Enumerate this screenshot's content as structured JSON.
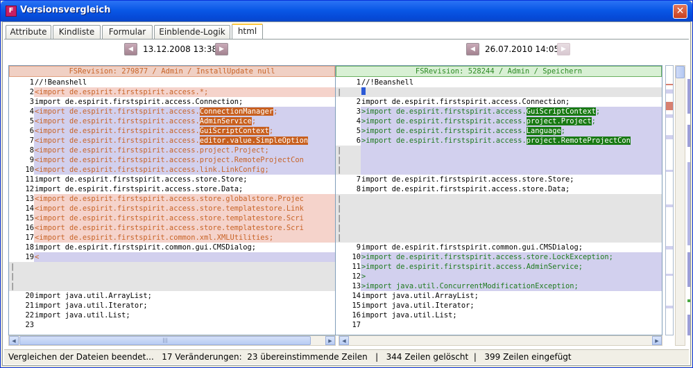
{
  "window": {
    "title": "Versionsvergleich",
    "app_icon": "fs-icon",
    "close_icon": "close-icon"
  },
  "tabs": [
    {
      "label": "Attribute"
    },
    {
      "label": "Kindliste"
    },
    {
      "label": "Formular"
    },
    {
      "label": "Einblende-Logik"
    },
    {
      "label": "html",
      "active": true
    }
  ],
  "left": {
    "date": "13.12.2008 13:38",
    "header": "FSRevision: 279877 / Admin / InstallUpdate null",
    "rows": [
      {
        "n": "1",
        "t": "n",
        "code": "//!Beanshell"
      },
      {
        "n": "2",
        "t": "del",
        "m": "<",
        "code": "import de.espirit.firstspirit.access.*;"
      },
      {
        "n": "3",
        "t": "n",
        "code": "import de.espirit.firstspirit.access.Connection;"
      },
      {
        "n": "4",
        "t": "mod",
        "m": "<",
        "code": "import de.espirit.firstspirit.access.",
        "hl": "ConnectionManager",
        "tail": ";"
      },
      {
        "n": "5",
        "t": "mod",
        "m": "<",
        "code": "import de.espirit.firstspirit.access.",
        "hl": "AdminService",
        "tail": ";"
      },
      {
        "n": "6",
        "t": "mod",
        "m": "<",
        "code": "import de.espirit.firstspirit.access.",
        "hl": "GuiScriptContext",
        "tail": ";"
      },
      {
        "n": "7",
        "t": "mod",
        "m": "<",
        "code": "import de.espirit.firstspirit.access.",
        "hl": "editor.value.SimpleOption",
        "tail": ""
      },
      {
        "n": "8",
        "t": "mod",
        "m": "<",
        "code": "import de.espirit.firstspirit.access.project.Project;"
      },
      {
        "n": "9",
        "t": "mod",
        "m": "<",
        "code": "import de.espirit.firstspirit.access.project.RemoteProjectCon"
      },
      {
        "n": "10",
        "t": "mod",
        "m": "<",
        "code": "import de.espirit.firstspirit.access.link.LinkConfig;"
      },
      {
        "n": "11",
        "t": "n",
        "code": "import de.espirit.firstspirit.access.store.Store;"
      },
      {
        "n": "12",
        "t": "n",
        "code": "import de.espirit.firstspirit.access.store.Data;"
      },
      {
        "n": "13",
        "t": "del",
        "m": "<",
        "code": "import de.espirit.firstspirit.access.store.globalstore.Projec"
      },
      {
        "n": "14",
        "t": "del",
        "m": "<",
        "code": "import de.espirit.firstspirit.access.store.templatestore.Link"
      },
      {
        "n": "15",
        "t": "del",
        "m": "<",
        "code": "import de.espirit.firstspirit.access.store.templatestore.Scri"
      },
      {
        "n": "16",
        "t": "del",
        "m": "<",
        "code": "import de.espirit.firstspirit.access.store.templatestore.Scri"
      },
      {
        "n": "17",
        "t": "del",
        "m": "<",
        "code": "import de.espirit.firstspirit.common.xml.XMLUtilities;"
      },
      {
        "n": "18",
        "t": "n",
        "code": "import de.espirit.firstspirit.common.gui.CMSDialog;"
      },
      {
        "n": "19",
        "t": "mod",
        "m": "<",
        "code": ""
      },
      {
        "n": "",
        "t": "fill",
        "code": ""
      },
      {
        "n": "",
        "t": "fill",
        "code": ""
      },
      {
        "n": "",
        "t": "fill",
        "code": ""
      },
      {
        "n": "20",
        "t": "n",
        "code": "import java.util.ArrayList;"
      },
      {
        "n": "21",
        "t": "n",
        "code": "import java.util.Iterator;"
      },
      {
        "n": "22",
        "t": "n",
        "code": "import java.util.List;"
      },
      {
        "n": "23",
        "t": "n",
        "code": ""
      }
    ]
  },
  "right": {
    "date": "26.07.2010 14:05",
    "header": "FSRevision: 528244 / Admin / Speichern",
    "rows": [
      {
        "n": "1",
        "t": "n",
        "code": "//!Beanshell"
      },
      {
        "n": "",
        "t": "cursor",
        "code": ""
      },
      {
        "n": "2",
        "t": "n",
        "code": "import de.espirit.firstspirit.access.Connection;"
      },
      {
        "n": "3",
        "t": "add",
        "m": ">",
        "code": "import de.espirit.firstspirit.access.",
        "hl": "GuiScriptContext",
        "tail": ";"
      },
      {
        "n": "4",
        "t": "add",
        "m": ">",
        "code": "import de.espirit.firstspirit.access.",
        "hl": "project.Project",
        "tail": ";"
      },
      {
        "n": "5",
        "t": "add",
        "m": ">",
        "code": "import de.espirit.firstspirit.access.",
        "hl": "Language",
        "tail": ";"
      },
      {
        "n": "6",
        "t": "add",
        "m": ">",
        "code": "import de.espirit.firstspirit.access.",
        "hl": "project.RemoteProjectCon",
        "tail": ""
      },
      {
        "n": "",
        "t": "fill2",
        "code": ""
      },
      {
        "n": "",
        "t": "fill2",
        "code": ""
      },
      {
        "n": "",
        "t": "fill2",
        "code": ""
      },
      {
        "n": "7",
        "t": "n",
        "code": "import de.espirit.firstspirit.access.store.Store;"
      },
      {
        "n": "8",
        "t": "n",
        "code": "import de.espirit.firstspirit.access.store.Data;"
      },
      {
        "n": "",
        "t": "fill",
        "code": ""
      },
      {
        "n": "",
        "t": "fill",
        "code": ""
      },
      {
        "n": "",
        "t": "fill",
        "code": ""
      },
      {
        "n": "",
        "t": "fill",
        "code": ""
      },
      {
        "n": "",
        "t": "fill",
        "code": ""
      },
      {
        "n": "9",
        "t": "n",
        "code": "import de.espirit.firstspirit.common.gui.CMSDialog;"
      },
      {
        "n": "10",
        "t": "add",
        "m": ">",
        "code": "import de.espirit.firstspirit.access.store.LockException;"
      },
      {
        "n": "11",
        "t": "add",
        "m": ">",
        "code": "import de.espirit.firstspirit.access.AdminService;"
      },
      {
        "n": "12",
        "t": "add",
        "m": ">",
        "code": ""
      },
      {
        "n": "13",
        "t": "add",
        "m": ">",
        "code": "import java.util.ConcurrentModificationException;"
      },
      {
        "n": "14",
        "t": "n",
        "code": "import java.util.ArrayList;"
      },
      {
        "n": "15",
        "t": "n",
        "code": "import java.util.Iterator;"
      },
      {
        "n": "16",
        "t": "n",
        "code": "import java.util.List;"
      },
      {
        "n": "17",
        "t": "n",
        "code": ""
      }
    ]
  },
  "status": {
    "text": "Vergleichen der Dateien beendet...   17 Veränderungen:  23 übereinstimmende Zeilen   |   344 Zeilen gelöscht  |   399 Zeilen eingefügt"
  },
  "colors": {
    "deleted": "#f5d3cb",
    "changed": "#d2d0ee",
    "highlight_left": "#c8601f",
    "highlight_right": "#197a14"
  }
}
